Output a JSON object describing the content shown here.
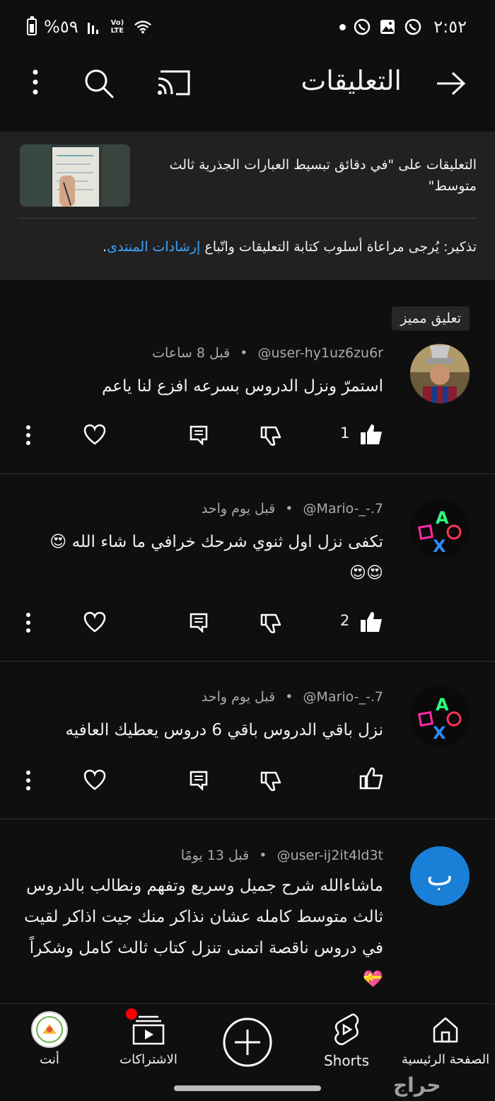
{
  "status_bar": {
    "battery_text": "%٥٩",
    "net_label": "Vo) LTE",
    "time": "٢:٥٢"
  },
  "header": {
    "title": "التعليقات"
  },
  "video": {
    "title": "التعليقات على \"في دقائق تبسيط العبارات الجذرية ثالث متوسط\"",
    "reminder_text": "تذكير: يُرجى مراعاة أسلوب كتابة التعليقات واتّباع ",
    "reminder_link": "إرشادات المنتدى",
    "reminder_end": "."
  },
  "pinned_badge": "تعليق مميز",
  "comments": [
    {
      "user": "@user-hy1uz6zu6r",
      "time": "قبل 8 ساعات",
      "text": "استمرّ ونزل الدروس بسرعه افزع لنا ياعم",
      "likes": "1",
      "sep": "•"
    },
    {
      "user": "@Mario-_-.7",
      "time": "قبل يوم واحد",
      "text": "تكفى نزل اول ثنوي شرحك خرافي  ما شاء الله 😍😍😍",
      "likes": "2",
      "sep": "•"
    },
    {
      "user": "@Mario-_-.7",
      "time": "قبل يوم واحد",
      "text": "نزل باقي الدروس باقي 6 دروس يعطيك العافيه",
      "likes": "",
      "sep": "•"
    },
    {
      "user": "@user-ij2it4ld3t",
      "time": "قبل 13 يومًا",
      "text": "ماشاءالله شرح جميل وسريع وتفهم ونطالب بالدروس ثالث متوسط كامله عشان نذاكر منك جيت اذاكر لقيت في دروس ناقصة اتمنى تنزل كتاب ثالث كامل وشكراً💝",
      "avatar_letter": "ب",
      "sep": "•"
    }
  ],
  "bottom_nav": {
    "home": "الصفحة الرئيسية",
    "shorts": "Shorts",
    "subscriptions": "الاشتراكات",
    "you": "أنت"
  },
  "watermark": "حراج",
  "colors": {
    "background": "#0f0f0f",
    "header_panel": "#212121",
    "link": "#3ea6ff",
    "avatar_blue": "#1a7fd6",
    "notification_dot": "#ff0000"
  }
}
